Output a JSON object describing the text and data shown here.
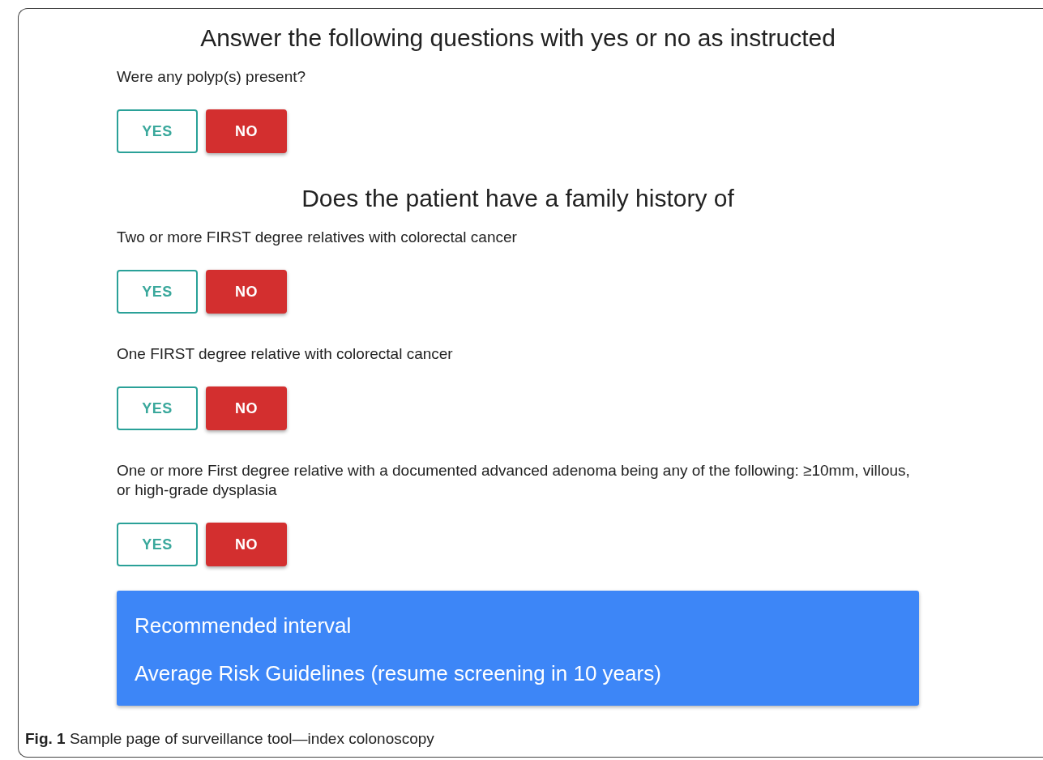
{
  "blocks": [
    {
      "kind": "heading",
      "text": "Answer the following questions with yes or no as instructed"
    },
    {
      "kind": "question",
      "text": "Were any polyp(s) present?",
      "answers": [
        {
          "label": "YES",
          "selected": false
        },
        {
          "label": "NO",
          "selected": true
        }
      ]
    },
    {
      "kind": "heading",
      "text": "Does the patient have a family history of"
    },
    {
      "kind": "question",
      "text": "Two or more FIRST degree relatives with colorectal cancer",
      "answers": [
        {
          "label": "YES",
          "selected": false
        },
        {
          "label": "NO",
          "selected": true
        }
      ]
    },
    {
      "kind": "question",
      "text": "One FIRST degree relative with colorectal cancer",
      "answers": [
        {
          "label": "YES",
          "selected": false
        },
        {
          "label": "NO",
          "selected": true
        }
      ]
    },
    {
      "kind": "question",
      "text": "One or more First degree relative with a documented advanced adenoma being any of the following: ≥10mm, villous, or high-grade dysplasia",
      "answers": [
        {
          "label": "YES",
          "selected": false
        },
        {
          "label": "NO",
          "selected": true
        }
      ]
    }
  ],
  "result": {
    "title": "Recommended interval",
    "text": "Average Risk Guidelines (resume screening in 10 years)"
  },
  "caption": "**Fig. 1**  Sample page of surveillance tool—index colonoscopy"
}
